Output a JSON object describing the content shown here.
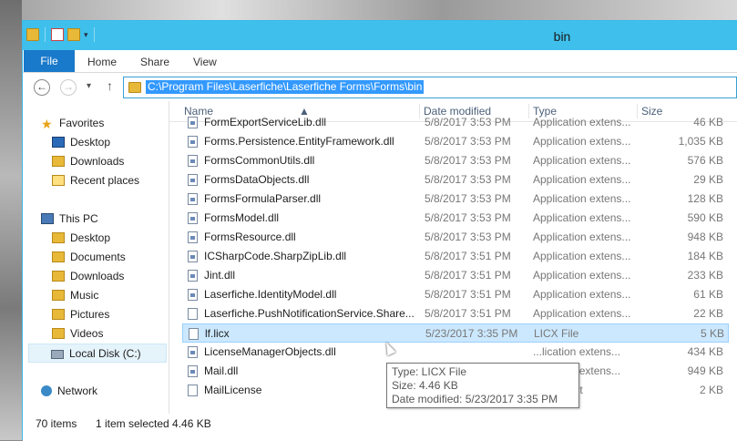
{
  "window": {
    "title": "bin"
  },
  "ribbon": {
    "tabs": [
      "File",
      "Home",
      "Share",
      "View"
    ]
  },
  "address": {
    "path": "C:\\Program Files\\Laserfiche\\Laserfiche Forms\\Forms\\bin"
  },
  "nav": {
    "favorites": "Favorites",
    "favorites_items": [
      "Desktop",
      "Downloads",
      "Recent places"
    ],
    "this_pc": "This PC",
    "pc_items": [
      "Desktop",
      "Documents",
      "Downloads",
      "Music",
      "Pictures",
      "Videos",
      "Local Disk (C:)"
    ],
    "network": "Network"
  },
  "columns": {
    "name": "Name",
    "date": "Date modified",
    "type": "Type",
    "size": "Size"
  },
  "files": [
    {
      "name": "FormExportServiceLib.dll",
      "date": "5/8/2017 3:53 PM",
      "type": "Application extens...",
      "size": "46 KB"
    },
    {
      "name": "Forms.Persistence.EntityFramework.dll",
      "date": "5/8/2017 3:53 PM",
      "type": "Application extens...",
      "size": "1,035 KB"
    },
    {
      "name": "FormsCommonUtils.dll",
      "date": "5/8/2017 3:53 PM",
      "type": "Application extens...",
      "size": "576 KB"
    },
    {
      "name": "FormsDataObjects.dll",
      "date": "5/8/2017 3:53 PM",
      "type": "Application extens...",
      "size": "29 KB"
    },
    {
      "name": "FormsFormulaParser.dll",
      "date": "5/8/2017 3:53 PM",
      "type": "Application extens...",
      "size": "128 KB"
    },
    {
      "name": "FormsModel.dll",
      "date": "5/8/2017 3:53 PM",
      "type": "Application extens...",
      "size": "590 KB"
    },
    {
      "name": "FormsResource.dll",
      "date": "5/8/2017 3:53 PM",
      "type": "Application extens...",
      "size": "948 KB"
    },
    {
      "name": "ICSharpCode.SharpZipLib.dll",
      "date": "5/8/2017 3:51 PM",
      "type": "Application extens...",
      "size": "184 KB"
    },
    {
      "name": "Jint.dll",
      "date": "5/8/2017 3:51 PM",
      "type": "Application extens...",
      "size": "233 KB"
    },
    {
      "name": "Laserfiche.IdentityModel.dll",
      "date": "5/8/2017 3:51 PM",
      "type": "Application extens...",
      "size": "61 KB"
    },
    {
      "name": "Laserfiche.PushNotificationService.Share...",
      "date": "5/8/2017 3:51 PM",
      "type": "Application extens...",
      "size": "22 KB"
    },
    {
      "name": "lf.licx",
      "date": "5/23/2017 3:35 PM",
      "type": "LICX File",
      "size": "5 KB"
    },
    {
      "name": "LicenseManagerObjects.dll",
      "date": "",
      "type": "...lication extens...",
      "size": "434 KB"
    },
    {
      "name": "Mail.dll",
      "date": "",
      "type": "...lication extens...",
      "size": "949 KB"
    },
    {
      "name": "MailLicense",
      "date": "",
      "type": "Document",
      "size": "2 KB"
    }
  ],
  "tooltip": {
    "type": "Type: LICX File",
    "size": "Size: 4.46 KB",
    "modified": "Date modified: 5/23/2017 3:35 PM"
  },
  "status": {
    "items": "70 items",
    "selected": "1 item selected  4.46 KB"
  },
  "colors": {
    "accent": "#3fc0ec",
    "file_tab": "#1979ca",
    "selection": "#cce8ff"
  }
}
